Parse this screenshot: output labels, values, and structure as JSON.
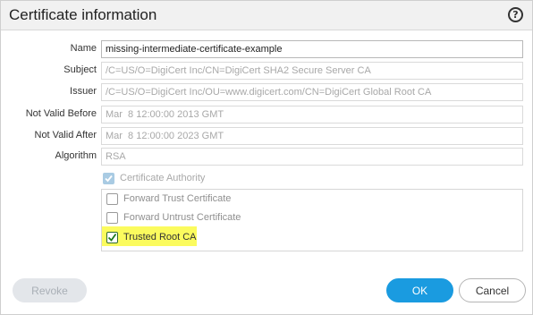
{
  "dialog": {
    "title": "Certificate information",
    "help_icon": "question-circle-icon",
    "help_glyph": "?"
  },
  "fields": {
    "name": {
      "label": "Name",
      "value": "missing-intermediate-certificate-example"
    },
    "subject": {
      "label": "Subject",
      "value": "/C=US/O=DigiCert Inc/CN=DigiCert SHA2 Secure Server CA"
    },
    "issuer": {
      "label": "Issuer",
      "value": "/C=US/O=DigiCert Inc/OU=www.digicert.com/CN=DigiCert Global Root CA"
    },
    "not_valid_before": {
      "label": "Not Valid Before",
      "value": "Mar  8 12:00:00 2013 GMT"
    },
    "not_valid_after": {
      "label": "Not Valid After",
      "value": "Mar  8 12:00:00 2023 GMT"
    },
    "algorithm": {
      "label": "Algorithm",
      "value": "RSA"
    }
  },
  "checkboxes": {
    "certificate_authority": {
      "label": "Certificate Authority",
      "checked": true,
      "enabled": false
    },
    "forward_trust": {
      "label": "Forward Trust Certificate",
      "checked": false
    },
    "forward_untrust": {
      "label": "Forward Untrust Certificate",
      "checked": false
    },
    "trusted_root_ca": {
      "label": "Trusted Root CA",
      "checked": true,
      "highlighted": true
    }
  },
  "buttons": {
    "revoke": "Revoke",
    "ok": "OK",
    "cancel": "Cancel"
  },
  "colors": {
    "accent": "#1a9be0",
    "highlight": "#fbfb5e",
    "check_green": "#2f8a2f"
  }
}
